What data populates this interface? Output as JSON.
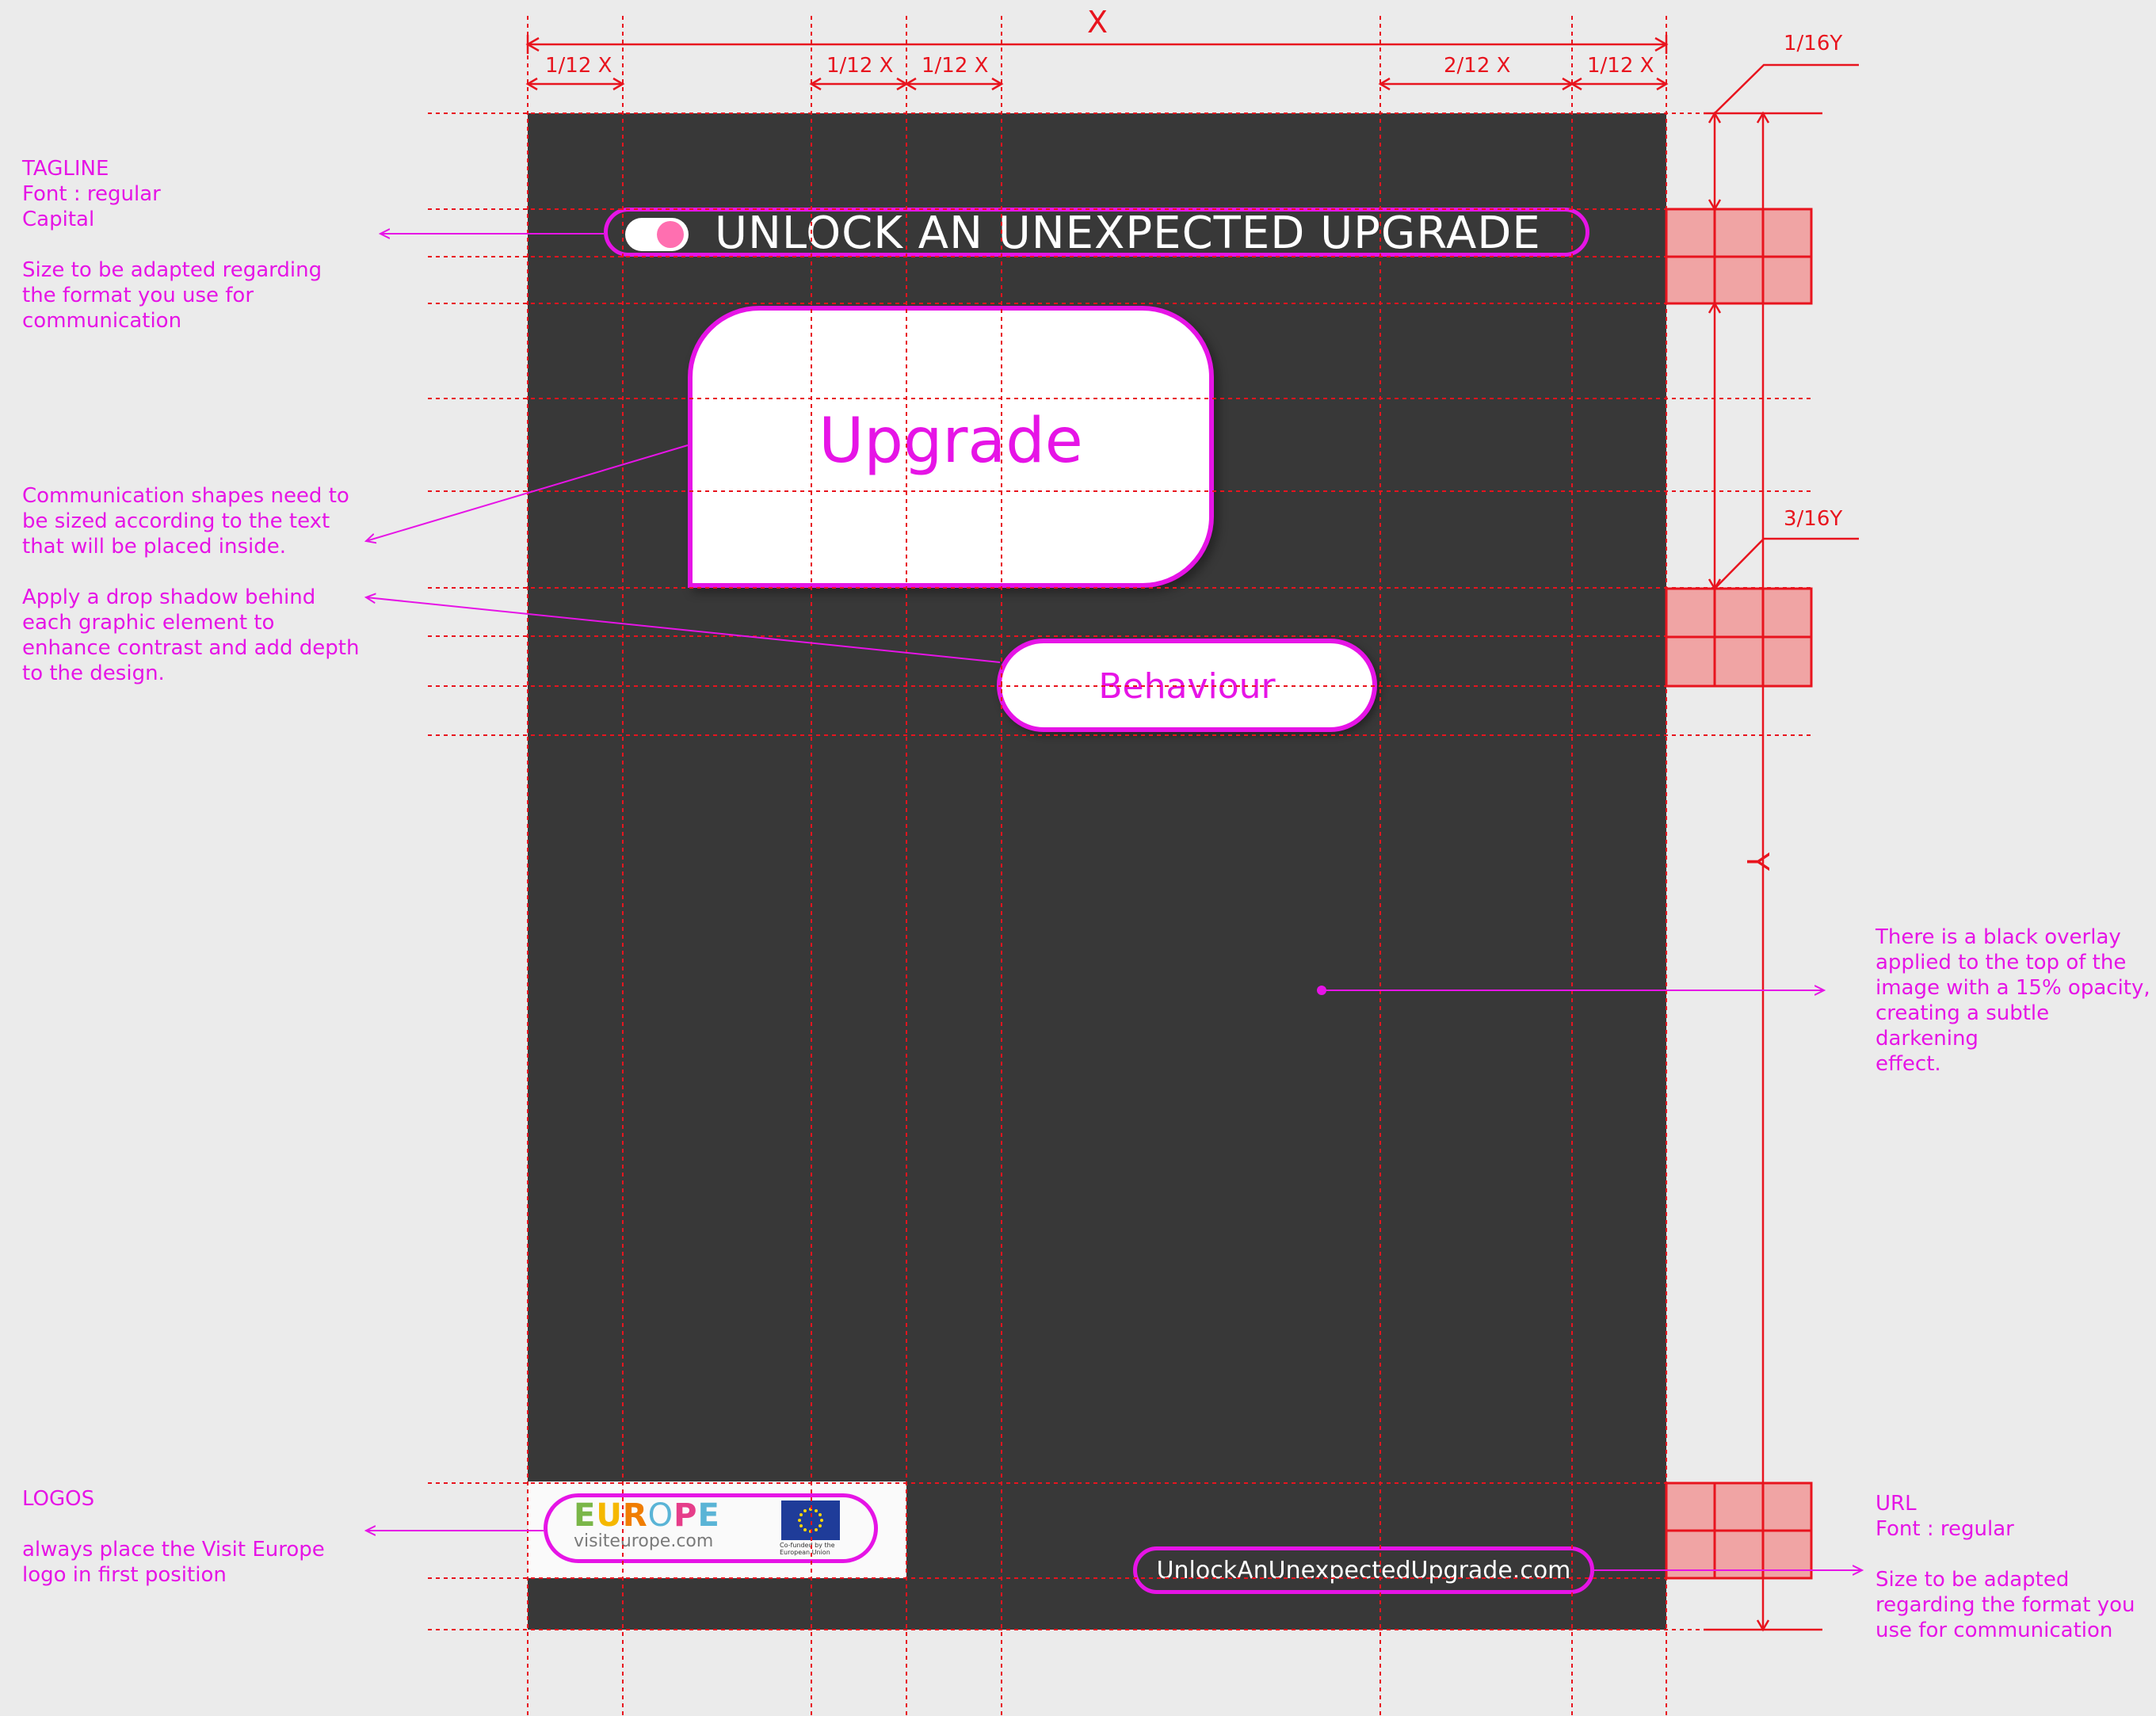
{
  "dimensions": {
    "x_label": "X",
    "y_label": "Y",
    "top_segments": [
      "1/12 X",
      "1/12 X",
      "1/12 X",
      "2/12 X",
      "1/12 X"
    ],
    "right_top_label": "1/16Y",
    "right_mid_label": "3/16Y"
  },
  "annotations": {
    "tagline": "TAGLINE\nFont : regular\nCapital\n\nSize to be adapted regarding\nthe format you use for\ncommunication",
    "shapes": "Communication shapes need to\nbe sized according to the text\nthat will be placed inside.",
    "shadow": "Apply a drop shadow behind\neach graphic element to\nenhance contrast and add depth\nto the design.",
    "overlay": "There is a black overlay\napplied to the top of the\nimage with a 15% opacity,\ncreating a subtle darkening\neffect.",
    "logos": "LOGOS\n\nalways place the Visit Europe\nlogo in first position",
    "url": "URL\nFont : regular\n\nSize to be adapted\nregarding the format you\nuse for communication"
  },
  "poster": {
    "tagline": "UNLOCK AN UNEXPECTED UPGRADE",
    "bubble_text": "Upgrade",
    "pill_text": "Behaviour",
    "url": "UnlockAnUnexpectedUpgrade.com",
    "logo": {
      "europe_letters": [
        "E",
        "U",
        "R",
        "O",
        "P",
        "E"
      ],
      "europe_url": "visiteurope.com",
      "eu_caption": "Co-funded by the\nEuropean Union"
    }
  },
  "colors": {
    "background": "#ebebeb",
    "poster": "#383838",
    "accent_magenta": "#e614e6",
    "guide_red": "#e8141e",
    "cell_fill": "#f0a4a4",
    "europe_letters": [
      "#7ab648",
      "#f5b800",
      "#f07d00",
      "#5ab4d6",
      "#e63e8a",
      "#5ab4d6"
    ]
  },
  "icons": {
    "toggle": "toggle-switch-icon",
    "flag": "eu-flag-icon"
  }
}
